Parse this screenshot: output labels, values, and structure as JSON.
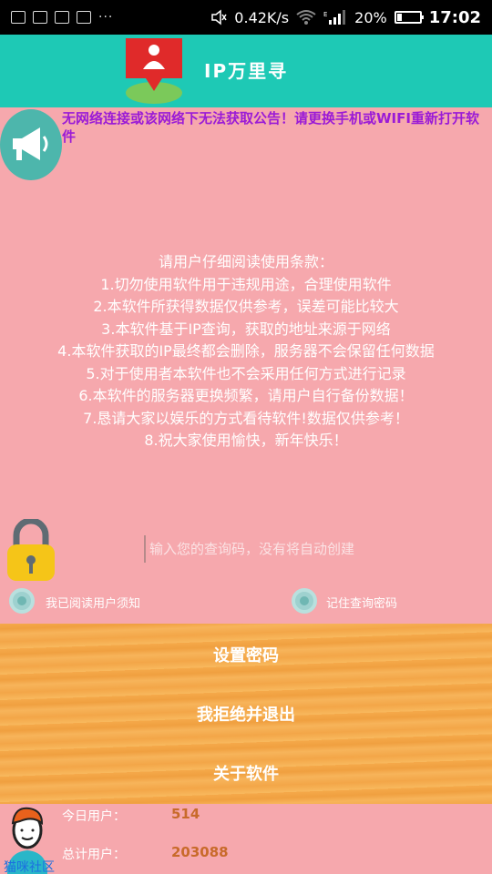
{
  "status_bar": {
    "network_speed": "0.42K/s",
    "signal_tag": "E",
    "battery_percent": "20%",
    "battery_level": 0.2,
    "time": "17:02"
  },
  "header": {
    "title": "IP万里寻"
  },
  "notice": {
    "text": "无网络连接或该网络下无法获取公告！请更换手机或WIFI重新打开软件"
  },
  "terms": {
    "heading": "请用户仔细阅读使用条款：",
    "items": [
      "1.切勿使用软件用于违规用途，合理使用软件",
      "2.本软件所获得数据仅供参考，误差可能比较大",
      "3.本软件基于IP查询，获取的地址来源于网络",
      "4.本软件获取的IP最终都会删除，服务器不会保留任何数据",
      "5.对于使用者本软件也不会采用任何方式进行记录",
      "6.本软件的服务器更换频繁，请用户自行备份数据！",
      "7.恳请大家以娱乐的方式看待软件!数据仅供参考！",
      "8.祝大家使用愉快，新年快乐！"
    ]
  },
  "query": {
    "placeholder": "输入您的查询码，没有将自动创建",
    "value": ""
  },
  "options": {
    "read_terms_label": "我已阅读用户须知",
    "remember_label": "记住查询密码"
  },
  "buttons": {
    "set_password": "设置密码",
    "refuse_exit": "我拒绝并退出",
    "about": "关于软件"
  },
  "stats": {
    "today_label": "今日用户：",
    "today_value": "514",
    "total_label": "总计用户：",
    "total_value": "203088"
  },
  "watermark": "猫咪社区",
  "colors": {
    "header": "#1ec9b5",
    "background": "#f6a8ad",
    "notice": "#9b1bd6",
    "button_area": "#f5a94a",
    "stat_value": "#c86a2a"
  }
}
